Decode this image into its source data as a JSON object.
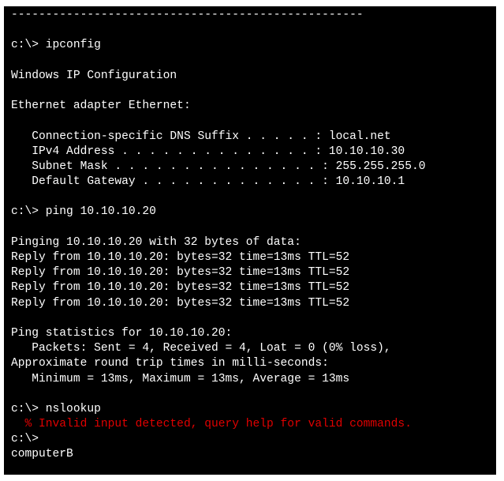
{
  "terminal": {
    "text_color": "#ffffff",
    "error_color": "#e00000",
    "background": "#000000",
    "lines": [
      {
        "text": "---------------------------------------------------",
        "type": "separator"
      },
      {
        "text": "",
        "type": "blank"
      },
      {
        "text": "c:\\> ipconfig",
        "type": "command"
      },
      {
        "text": "",
        "type": "blank"
      },
      {
        "text": "Windows IP Configuration",
        "type": "output"
      },
      {
        "text": "",
        "type": "blank"
      },
      {
        "text": "Ethernet adapter Ethernet:",
        "type": "output"
      },
      {
        "text": "",
        "type": "blank"
      },
      {
        "text": "   Connection-specific DNS Suffix . . . . . : local.net",
        "type": "output"
      },
      {
        "text": "   IPv4 Address . . . . . . . . . . . . . . : 10.10.10.30",
        "type": "output"
      },
      {
        "text": "   Subnet Mask . . . . . . . . . . . . . . . : 255.255.255.0",
        "type": "output"
      },
      {
        "text": "   Default Gateway . . . . . . . . . . . . . : 10.10.10.1",
        "type": "output"
      },
      {
        "text": "",
        "type": "blank"
      },
      {
        "text": "c:\\> ping 10.10.10.20",
        "type": "command"
      },
      {
        "text": "",
        "type": "blank"
      },
      {
        "text": "Pinging 10.10.10.20 with 32 bytes of data:",
        "type": "output"
      },
      {
        "text": "Reply from 10.10.10.20: bytes=32 time=13ms TTL=52",
        "type": "output"
      },
      {
        "text": "Reply from 10.10.10.20: bytes=32 time=13ms TTL=52",
        "type": "output"
      },
      {
        "text": "Reply from 10.10.10.20: bytes=32 time=13ms TTL=52",
        "type": "output"
      },
      {
        "text": "Reply from 10.10.10.20: bytes=32 time=13ms TTL=52",
        "type": "output"
      },
      {
        "text": "",
        "type": "blank"
      },
      {
        "text": "Ping statistics for 10.10.10.20:",
        "type": "output"
      },
      {
        "text": "   Packets: Sent = 4, Received = 4, Loat = 0 (0% loss),",
        "type": "output"
      },
      {
        "text": "Approximate round trip times in milli-seconds:",
        "type": "output"
      },
      {
        "text": "   Minimum = 13ms, Maximum = 13ms, Average = 13ms",
        "type": "output"
      },
      {
        "text": "",
        "type": "blank"
      },
      {
        "text": "c:\\> nslookup",
        "type": "command"
      },
      {
        "text": "  % Invalid input detected, query help for valid commands.",
        "type": "error"
      },
      {
        "text": "c:\\>",
        "type": "prompt"
      },
      {
        "text": "computerB",
        "type": "input"
      }
    ]
  }
}
